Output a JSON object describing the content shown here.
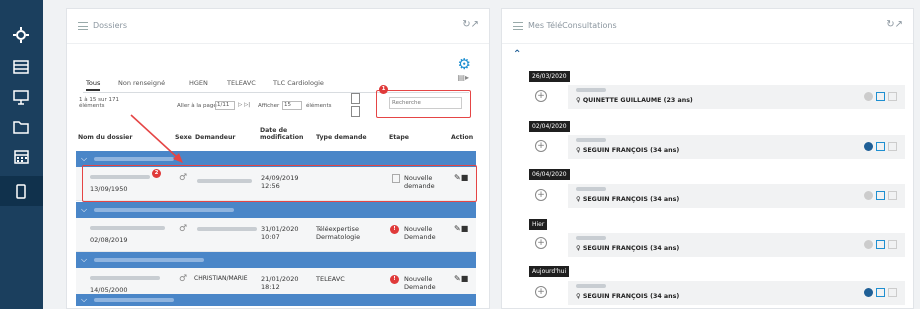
{
  "dossiers": {
    "title": "Dossiers",
    "tabs": [
      "Tous",
      "Non renseigné",
      "HGEN",
      "TELEAVC",
      "TLC Cardiologie"
    ],
    "count_text": "1 à 15 sur 171\néléments",
    "goto_page": "Aller à la page",
    "page_value": "1/11",
    "show_label": "Afficher",
    "show_value": "15",
    "elements_label": "éléments",
    "search_placeholder": "Recherche",
    "columns": [
      "Nom du dossier",
      "Sexe",
      "Demandeur",
      "Date de\nmodification",
      "Type demande",
      "Etape",
      "Action"
    ],
    "rows": [
      {
        "date_naissance": "13/09/1950",
        "sexe": "♂",
        "modif": "24/09/2019\n12:56",
        "type": "",
        "etape": "Nouvelle\ndemande"
      },
      {
        "date_naissance": "02/08/2019",
        "sexe": "♂",
        "modif": "31/01/2020\n10:07",
        "type": "Téléexpertise\nDermatologie",
        "etape": "Nouvelle\nDemande"
      },
      {
        "date_naissance": "14/05/2000",
        "sexe": "♂",
        "demandeur": "CHRISTIAN/MARIE",
        "modif": "21/01/2020\n18:12",
        "type": "TELEAVC",
        "etape": "Nouvelle\nDemande"
      }
    ],
    "annotation_1": "1",
    "annotation_2": "2"
  },
  "teleconsult": {
    "title": "Mes TéléConsultations",
    "groups": [
      {
        "date": "26/03/2020",
        "patient": "QUINETTE GUILLAUME (23 ans)"
      },
      {
        "date": "02/04/2020",
        "patient": "SEGUIN FRANÇOIS (34 ans)"
      },
      {
        "date": "06/04/2020",
        "patient": "SEGUIN FRANÇOIS (34 ans)"
      },
      {
        "date": "Hier",
        "patient": "SEGUIN FRANÇOIS (34 ans)"
      },
      {
        "date": "Aujourd'hui",
        "patient": "SEGUIN FRANÇOIS (34 ans)"
      }
    ]
  },
  "colors": {
    "sidebar": "#1b3f5e",
    "group_row": "#4a86c8",
    "highlight": "#e54545",
    "gear": "#1e8fd1"
  }
}
